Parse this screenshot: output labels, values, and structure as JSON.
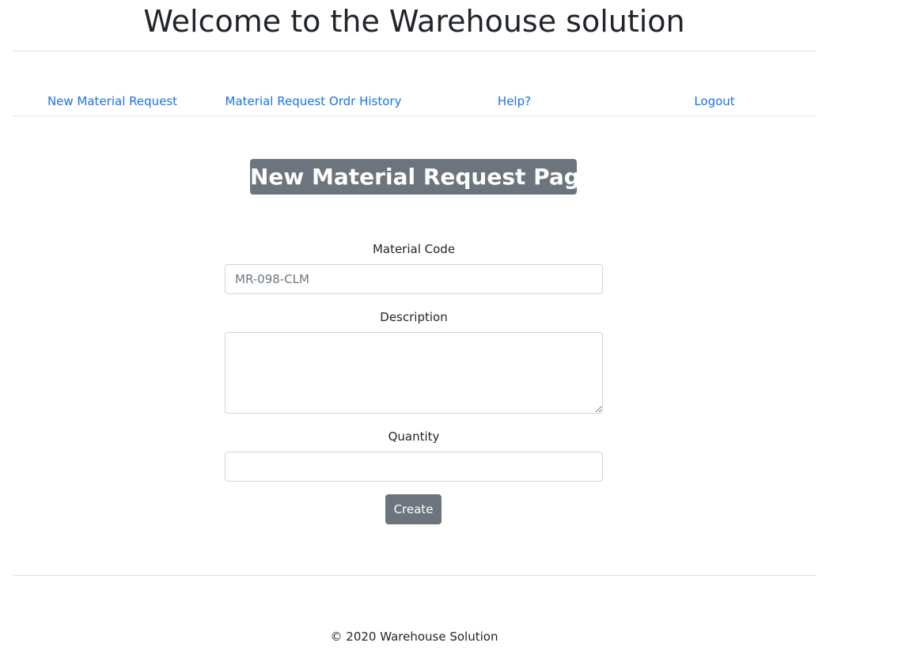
{
  "header": {
    "title": "Welcome to the Warehouse solution"
  },
  "nav": {
    "items": [
      {
        "label": "New Material Request"
      },
      {
        "label": "Material Request Ordr History"
      },
      {
        "label": "Help?"
      },
      {
        "label": "Logout"
      }
    ],
    "link_color": "#1a73e8"
  },
  "main": {
    "heading": "New Material Request Page",
    "form": {
      "material_code": {
        "label": "Material Code",
        "value": "",
        "placeholder": "MR-098-CLM"
      },
      "description": {
        "label": "Description",
        "value": "",
        "placeholder": ""
      },
      "quantity": {
        "label": "Quantity",
        "value": "",
        "placeholder": ""
      },
      "create_label": "Create"
    }
  },
  "footer": {
    "text": "© 2020 Warehouse Solution"
  },
  "colors": {
    "heading_bg": "#6c757d",
    "button_bg": "#6c757d",
    "divider": "#dee2e6"
  }
}
